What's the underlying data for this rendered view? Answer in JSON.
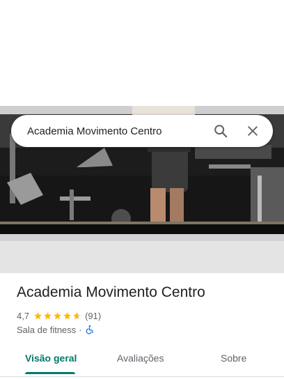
{
  "search": {
    "query": "Academia Movimento Centro"
  },
  "place": {
    "name": "Academia Movimento Centro",
    "rating": "4,7",
    "rating_value": 4.7,
    "stars_max": 5,
    "review_count": "(91)",
    "category": "Sala de fitness",
    "separator": "·"
  },
  "tabs": [
    {
      "label": "Visão geral",
      "active": true
    },
    {
      "label": "Avaliações",
      "active": false
    },
    {
      "label": "Sobre",
      "active": false
    }
  ],
  "colors": {
    "accent": "#00796b",
    "star": "#fbbc04",
    "accessibility_icon": "#1a73e8"
  },
  "icons": {
    "search": "search-icon",
    "close": "close-icon",
    "accessibility": "wheelchair-accessible-icon"
  },
  "photo": {
    "subject": "gym-mirror-photo"
  }
}
